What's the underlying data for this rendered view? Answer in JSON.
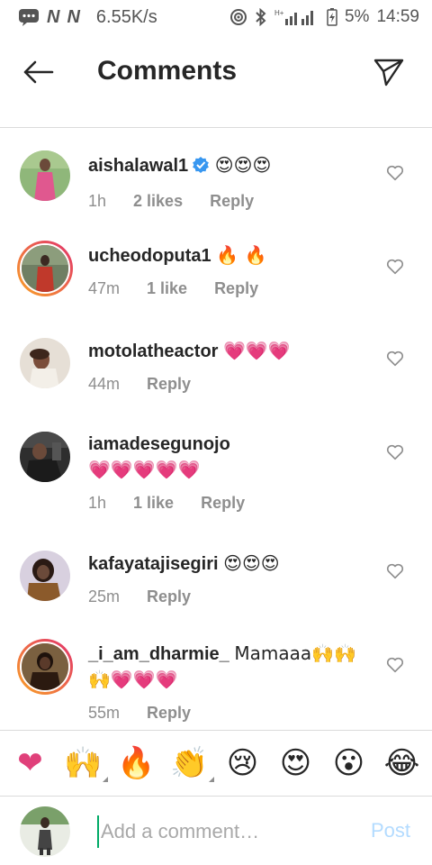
{
  "status_bar": {
    "carrier_icons": [
      "N",
      "N"
    ],
    "speed": "6.55K/s",
    "battery": "5%",
    "time": "14:59"
  },
  "header": {
    "title": "Comments"
  },
  "comments": [
    {
      "username": "aishalawal1",
      "verified": true,
      "text": "😍😍😍",
      "time": "1h",
      "likes": "2 likes",
      "reply": "Reply",
      "story_ring": false,
      "avatar_colors": [
        "#7fae6a",
        "#e0588f"
      ]
    },
    {
      "username": "ucheodoputa1",
      "verified": false,
      "text": "🔥 🔥",
      "time": "47m",
      "likes": "1 like",
      "reply": "Reply",
      "story_ring": true,
      "avatar_colors": [
        "#5b6b54",
        "#c0392b"
      ]
    },
    {
      "username": "motolatheactor",
      "verified": false,
      "text": "💗💗💗",
      "time": "44m",
      "likes": "",
      "reply": "Reply",
      "story_ring": false,
      "avatar_colors": [
        "#d8cfc4",
        "#5a3b2e"
      ]
    },
    {
      "username": "iamadesegunojo",
      "verified": false,
      "text": "💗💗💗💗💗",
      "time": "1h",
      "likes": "1 like",
      "reply": "Reply",
      "story_ring": false,
      "avatar_colors": [
        "#3a3a3a",
        "#1b1b1b"
      ]
    },
    {
      "username": "kafayatajisegiri",
      "verified": false,
      "text": "😍😍😍",
      "time": "25m",
      "likes": "",
      "reply": "Reply",
      "story_ring": false,
      "avatar_colors": [
        "#cfc6d6",
        "#3b2a22"
      ]
    },
    {
      "username": "_i_am_dharmie_",
      "verified": false,
      "text": "Mamaaa🙌🙌🙌💗💗💗",
      "time": "55m",
      "likes": "",
      "reply": "Reply",
      "story_ring": true,
      "avatar_colors": [
        "#6b5436",
        "#2b1a10"
      ]
    }
  ],
  "emoji_bar": [
    {
      "emoji": "❤",
      "name": "heart",
      "variants": false
    },
    {
      "emoji": "🙌",
      "name": "raised-hands",
      "variants": true
    },
    {
      "emoji": "🔥",
      "name": "fire",
      "variants": false
    },
    {
      "emoji": "👏",
      "name": "clapping-hands",
      "variants": true
    },
    {
      "emoji": "😢",
      "name": "crying-face",
      "variants": false
    },
    {
      "emoji": "😍",
      "name": "heart-eyes",
      "variants": false
    },
    {
      "emoji": "😮",
      "name": "surprised-face",
      "variants": false
    },
    {
      "emoji": "😂",
      "name": "laughing-face",
      "variants": false
    }
  ],
  "input": {
    "placeholder": "Add a comment…",
    "value": "",
    "post_label": "Post"
  },
  "colors": {
    "accent_blue": "#3897f0",
    "post_disabled": "#b3dbff",
    "meta_gray": "#8e8e8e",
    "divider": "#dbdbdb",
    "story_gradient": [
      "#f9a326",
      "#e1306c"
    ]
  }
}
